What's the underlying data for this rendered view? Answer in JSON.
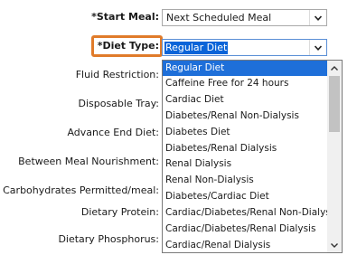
{
  "form": {
    "start_meal_label": "*Start Meal:",
    "start_meal_value": "Next Scheduled Meal",
    "diet_type_label": "*Diet Type:",
    "diet_type_value": "Regular Diet",
    "fluid_restriction_label": "Fluid Restriction:",
    "disposable_tray_label": "Disposable Tray:",
    "advance_end_diet_label": "Advance End Diet:",
    "between_meal_nourishment_label": "Between Meal Nourishment:",
    "carbohydrates_permitted_label": "Carbohydrates Permitted/meal:",
    "dietary_protein_label": "Dietary Protein:",
    "dietary_phosphorus_label": "Dietary Phosphorus:"
  },
  "dropdown": {
    "options": [
      "Regular Diet",
      "Caffeine Free for 24 hours",
      "Cardiac Diet",
      "Diabetes/Renal Non-Dialysis",
      "Diabetes Diet",
      "Diabetes/Renal Dialysis",
      "Renal Dialysis",
      "Renal Non-Dialysis",
      "Diabetes/Cardiac Diet",
      "Cardiac/Diabetes/Renal Non-Dialysis",
      "Cardiac/Diabetes/Renal Dialysis",
      "Cardiac/Renal Dialysis"
    ],
    "selected_index": 0
  },
  "icons": {
    "select_arrow": "chevron-down-icon",
    "scroll_up": "scroll-up-arrow-icon",
    "scroll_down": "scroll-down-arrow-icon"
  },
  "colors": {
    "highlight_border": "#e07b2a",
    "selection": "#1e6fd9"
  }
}
